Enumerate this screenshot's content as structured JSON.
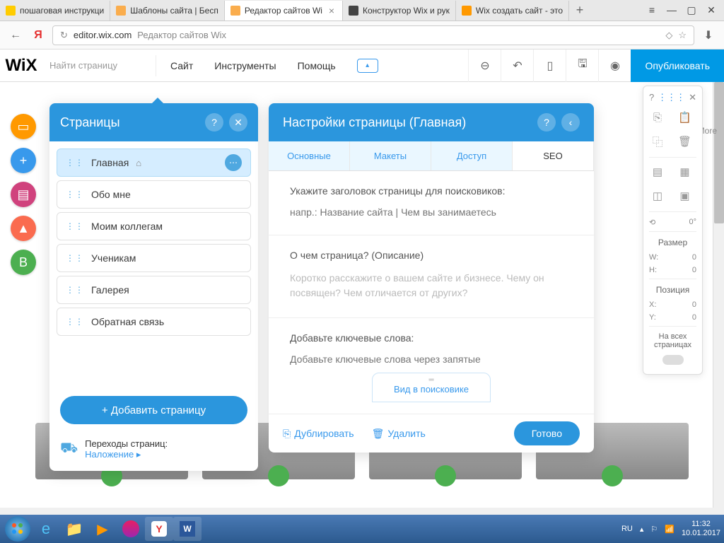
{
  "browser": {
    "tabs": [
      {
        "title": "пошаговая инструкци",
        "favicon": "#ff0000"
      },
      {
        "title": "Шаблоны сайта | Бесп",
        "favicon": "#faad4d"
      },
      {
        "title": "Редактор сайтов Wi",
        "favicon": "#faad4d",
        "active": true
      },
      {
        "title": "Конструктор Wix и рук",
        "favicon": "#333"
      },
      {
        "title": "Wix создать сайт - это",
        "favicon": "#ff9900"
      }
    ],
    "url_domain": "editor.wix.com",
    "url_title": "Редактор сайтов Wix"
  },
  "topbar": {
    "logo": "WiX",
    "search_placeholder": "Найти страницу",
    "menu": [
      "Сайт",
      "Инструменты",
      "Помощь"
    ],
    "publish": "Опубликовать"
  },
  "pages_panel": {
    "title": "Страницы",
    "items": [
      "Главная",
      "Обо мне",
      "Моим коллегам",
      "Ученикам",
      "Галерея",
      "Обратная связь"
    ],
    "add_page": "+  Добавить страницу",
    "transitions_label": "Переходы страниц:",
    "transitions_value": "Наложение ▸"
  },
  "settings_panel": {
    "title": "Настройки страницы (Главная)",
    "tabs": [
      "Основные",
      "Макеты",
      "Доступ",
      "SEO"
    ],
    "seo_title_label": "Укажите заголовок страницы для поисковиков:",
    "seo_title_placeholder": "напр.: Название сайта | Чем вы занимаетесь",
    "seo_desc_label": "О чем страница? (Описание)",
    "seo_desc_placeholder": "Коротко расскажите о вашем сайте и бизнесе. Чему он посвящен? Чем отличается от других?",
    "seo_keywords_label": "Добавьте ключевые слова:",
    "seo_keywords_placeholder": "Добавьте ключевые слова через запятые",
    "preview_label": "Вид в поисковике",
    "duplicate": "Дублировать",
    "delete": "Удалить",
    "done": "Готово"
  },
  "props": {
    "angle": "0°",
    "size_label": "Размер",
    "w_label": "W:",
    "w_val": "0",
    "h_label": "H:",
    "h_val": "0",
    "pos_label": "Позиция",
    "x_label": "X:",
    "x_val": "0",
    "y_label": "Y:",
    "y_val": "0",
    "allpages": "На всех страницах"
  },
  "more_text": "More",
  "taskbar": {
    "lang": "RU",
    "time": "11:32",
    "date": "10.01.2017"
  }
}
